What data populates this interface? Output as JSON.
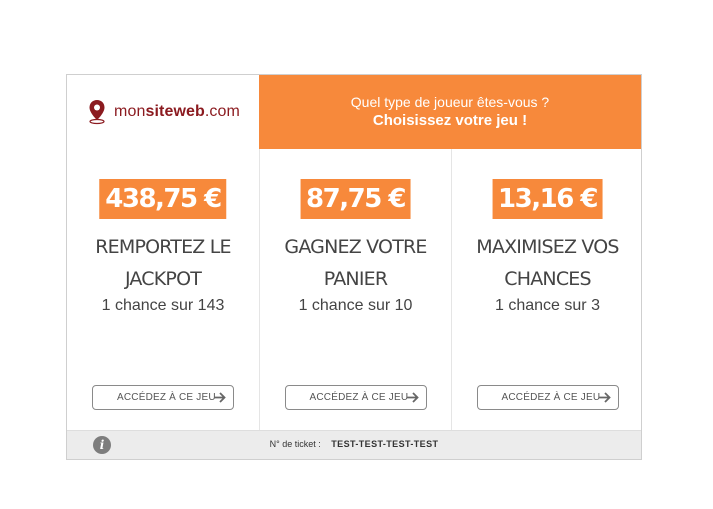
{
  "logo": {
    "text_light": "mon",
    "text_bold": "siteweb",
    "text_suffix": ".com",
    "icon": "map-pin-icon"
  },
  "header": {
    "question": "Quel type de joueur êtes-vous ?",
    "call_to_action": "Choisissez votre jeu !"
  },
  "games": [
    {
      "amount": "438,75 €",
      "title_line1": "REMPORTEZ LE",
      "title_line2": "JACKPOT",
      "odds": "1 chance sur 143",
      "button": "ACCÉDEZ À CE JEU"
    },
    {
      "amount": "87,75 €",
      "title_line1": "GAGNEZ VOTRE",
      "title_line2": "PANIER",
      "odds": "1 chance sur 10",
      "button": "ACCÉDEZ À CE JEU"
    },
    {
      "amount": "13,16 €",
      "title_line1": "MAXIMISEZ VOS",
      "title_line2": "CHANCES",
      "odds": "1 chance sur 3",
      "button": "ACCÉDEZ À CE JEU"
    }
  ],
  "footer": {
    "info_icon": "i",
    "ticket_label": "N° de ticket :",
    "ticket_value": "TEST-TEST-TEST-TEST"
  },
  "colors": {
    "accent": "#f7893b",
    "brand": "#8b1a1f",
    "footer_bg": "#ececec"
  }
}
